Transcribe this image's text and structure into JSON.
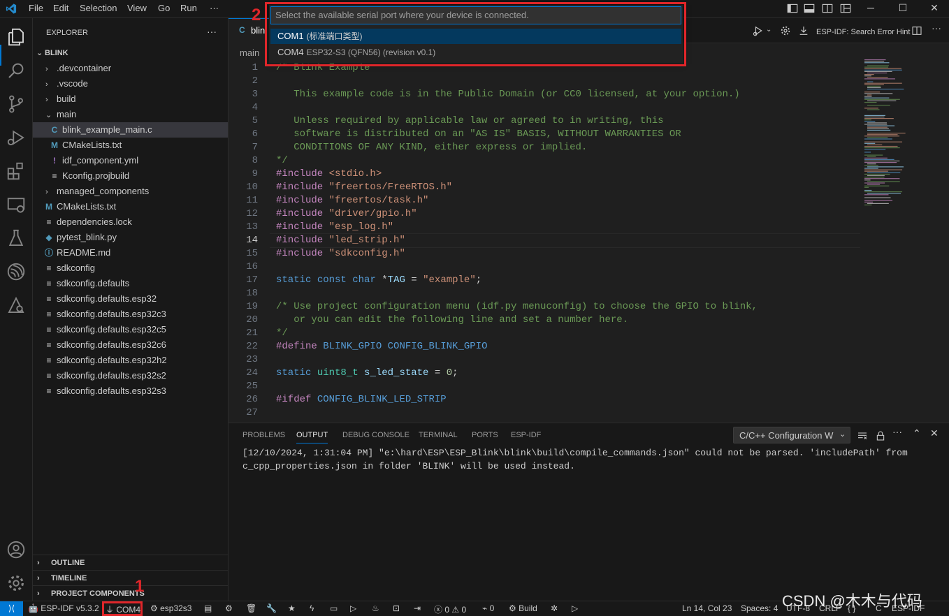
{
  "titlebar": {
    "menus": [
      "File",
      "Edit",
      "Selection",
      "View",
      "Go",
      "Run",
      "···"
    ],
    "logo_icon": "vscode-logo",
    "window_controls": [
      "layout-sidebar-icon",
      "layout-panel-icon",
      "layout-secondary-icon",
      "layout-customize-icon",
      "minimize-icon",
      "maximize-icon",
      "close-icon"
    ]
  },
  "activitybar": {
    "icons": [
      "explorer-icon",
      "search-icon",
      "source-control-icon",
      "run-debug-icon",
      "extensions-icon",
      "remote-explorer-icon",
      "testing-icon",
      "espressif-icon",
      "esp-idf-explorer-icon"
    ],
    "bottom_icons": [
      "account-icon",
      "manage-gear-icon"
    ]
  },
  "sidebar": {
    "title": "EXPLORER",
    "more": "···",
    "root": "BLINK",
    "items": [
      {
        "label": ".devcontainer",
        "type": "folder",
        "chev": "›",
        "depth": 1
      },
      {
        "label": ".vscode",
        "type": "folder",
        "chev": "›",
        "depth": 1
      },
      {
        "label": "build",
        "type": "folder",
        "chev": "›",
        "depth": 1
      },
      {
        "label": "main",
        "type": "folder",
        "chev": "⌄",
        "depth": 1
      },
      {
        "label": "blink_example_main.c",
        "type": "c",
        "icon": "C",
        "depth": 2,
        "selected": true
      },
      {
        "label": "CMakeLists.txt",
        "type": "cmake",
        "icon": "M",
        "depth": 2
      },
      {
        "label": "idf_component.yml",
        "type": "yml",
        "icon": "!",
        "depth": 2
      },
      {
        "label": "Kconfig.projbuild",
        "type": "text",
        "icon": "≡",
        "depth": 2
      },
      {
        "label": "managed_components",
        "type": "folder",
        "chev": "›",
        "depth": 1
      },
      {
        "label": "CMakeLists.txt",
        "type": "cmake",
        "icon": "M",
        "depth": 1
      },
      {
        "label": "dependencies.lock",
        "type": "text",
        "icon": "≡",
        "depth": 1
      },
      {
        "label": "pytest_blink.py",
        "type": "py",
        "icon": "◆",
        "depth": 1
      },
      {
        "label": "README.md",
        "type": "info",
        "icon": "ⓘ",
        "depth": 1
      },
      {
        "label": "sdkconfig",
        "type": "text",
        "icon": "≡",
        "depth": 1
      },
      {
        "label": "sdkconfig.defaults",
        "type": "text",
        "icon": "≡",
        "depth": 1
      },
      {
        "label": "sdkconfig.defaults.esp32",
        "type": "text",
        "icon": "≡",
        "depth": 1
      },
      {
        "label": "sdkconfig.defaults.esp32c3",
        "type": "text",
        "icon": "≡",
        "depth": 1
      },
      {
        "label": "sdkconfig.defaults.esp32c5",
        "type": "text",
        "icon": "≡",
        "depth": 1
      },
      {
        "label": "sdkconfig.defaults.esp32c6",
        "type": "text",
        "icon": "≡",
        "depth": 1
      },
      {
        "label": "sdkconfig.defaults.esp32h2",
        "type": "text",
        "icon": "≡",
        "depth": 1
      },
      {
        "label": "sdkconfig.defaults.esp32s2",
        "type": "text",
        "icon": "≡",
        "depth": 1
      },
      {
        "label": "sdkconfig.defaults.esp32s3",
        "type": "text",
        "icon": "≡",
        "depth": 1
      }
    ],
    "sections": [
      "OUTLINE",
      "TIMELINE",
      "PROJECT COMPONENTS"
    ]
  },
  "editor": {
    "tab_label": "blin",
    "tab_icon": "C",
    "breadcrumb": "main",
    "toolbar_hint": "ESP-IDF: Search Error Hint",
    "current_line": 14,
    "lines": [
      {
        "n": "1",
        "html": "<span class='cmt'>/* Blink Example</span>"
      },
      {
        "n": "2",
        "html": ""
      },
      {
        "n": "3",
        "html": "<span class='cmt'>   This example code is in the Public Domain (or CC0 licensed, at your option.)</span>"
      },
      {
        "n": "4",
        "html": ""
      },
      {
        "n": "5",
        "html": "<span class='cmt'>   Unless required by applicable law or agreed to in writing, this</span>"
      },
      {
        "n": "6",
        "html": "<span class='cmt'>   software is distributed on an \"AS IS\" BASIS, WITHOUT WARRANTIES OR</span>"
      },
      {
        "n": "7",
        "html": "<span class='cmt'>   CONDITIONS OF ANY KIND, either express or implied.</span>"
      },
      {
        "n": "8",
        "html": "<span class='cmt'>*/</span>"
      },
      {
        "n": "9",
        "html": "<span class='pp'>#include</span> <span class='str'>&lt;stdio.h&gt;</span>"
      },
      {
        "n": "10",
        "html": "<span class='pp'>#include</span> <span class='str'>\"freertos/FreeRTOS.h\"</span>"
      },
      {
        "n": "11",
        "html": "<span class='pp'>#include</span> <span class='str'>\"freertos/task.h\"</span>"
      },
      {
        "n": "12",
        "html": "<span class='pp'>#include</span> <span class='str'>\"driver/gpio.h\"</span>"
      },
      {
        "n": "13",
        "html": "<span class='pp'>#include</span> <span class='str'>\"esp_log.h\"</span>"
      },
      {
        "n": "14",
        "html": "<span class='pp'>#include</span> <span class='str'>\"led_strip.h\"</span>"
      },
      {
        "n": "15",
        "html": "<span class='pp'>#include</span> <span class='str'>\"sdkconfig.h\"</span>"
      },
      {
        "n": "16",
        "html": ""
      },
      {
        "n": "17",
        "html": "<span class='kw'>static</span> <span class='kw'>const</span> <span class='kw'>char</span> *<span class='id'>TAG</span> = <span class='str'>\"example\"</span>;"
      },
      {
        "n": "18",
        "html": ""
      },
      {
        "n": "19",
        "html": "<span class='cmt'>/* Use project configuration menu (idf.py menuconfig) to choose the GPIO to blink,</span>"
      },
      {
        "n": "20",
        "html": "<span class='cmt'>   or you can edit the following line and set a number here.</span>"
      },
      {
        "n": "21",
        "html": "<span class='cmt'>*/</span>"
      },
      {
        "n": "22",
        "html": "<span class='pp'>#define</span> <span class='mac'>BLINK_GPIO</span> <span class='mac'>CONFIG_BLINK_GPIO</span>"
      },
      {
        "n": "23",
        "html": ""
      },
      {
        "n": "24",
        "html": "<span class='kw'>static</span> <span class='ty'>uint8_t</span> <span class='id'>s_led_state</span> = <span class='num'>0</span>;"
      },
      {
        "n": "25",
        "html": ""
      },
      {
        "n": "26",
        "html": "<span class='pp'>#ifdef</span> <span class='mac'>CONFIG_BLINK_LED_STRIP</span>"
      },
      {
        "n": "27",
        "html": ""
      }
    ]
  },
  "panel": {
    "tabs": [
      "PROBLEMS",
      "OUTPUT",
      "DEBUG CONSOLE",
      "TERMINAL",
      "PORTS",
      "ESP-IDF"
    ],
    "active_tab": "OUTPUT",
    "output_channel": "C/C++ Configuration W",
    "output_lines": [
      "[12/10/2024, 1:31:04 PM] \"e:\\hard\\ESP\\ESP_Blink\\blink\\build\\compile_commands.json\" could not be parsed. 'includePath' from",
      "c_cpp_properties.json in folder 'BLINK' will be used instead."
    ]
  },
  "quickpick": {
    "placeholder": "Select the available serial port where your device is connected.",
    "items": [
      {
        "label": "COM1",
        "description": "(标准端口类型)",
        "selected": true
      },
      {
        "label": "COM4",
        "description": "ESP32-S3 (QFN56) (revision v0.1)",
        "selected": false
      }
    ]
  },
  "statusbar": {
    "esp_idf_version": "ESP-IDF v5.3.2",
    "port": "COM4",
    "target": "esp32s3",
    "errors": "0",
    "warnings": "0",
    "ports_count": "0",
    "build": "Build",
    "position": "Ln 14, Col 23",
    "spaces": "Spaces: 4",
    "encoding": "UTF-8",
    "eol": "CRLF",
    "braces": "{ }",
    "language": "C",
    "esp_idf": "ESP-IDF"
  },
  "annotations": {
    "marker1": "1",
    "marker2": "2",
    "color": "#e0262a"
  },
  "watermark": "CSDN @木木与代码"
}
